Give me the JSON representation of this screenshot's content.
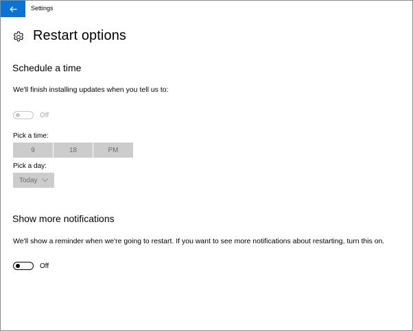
{
  "app": {
    "title": "Settings"
  },
  "page": {
    "title": "Restart options"
  },
  "schedule": {
    "heading": "Schedule a time",
    "description": "We'll finish installing updates when you tell us to:",
    "toggle_state": "Off",
    "pick_time_label": "Pick a time:",
    "hour": "9",
    "minute": "18",
    "ampm": "PM",
    "pick_day_label": "Pick a day:",
    "day": "Today"
  },
  "notifications": {
    "heading": "Show more notifications",
    "description": "We'll show a reminder when we're going to restart. If you want to see more notifications about restarting, turn this on.",
    "toggle_state": "Off"
  },
  "colors": {
    "accent": "#0a74d6",
    "disabled_fill": "#cccccc",
    "disabled_text": "#a8a8a8"
  },
  "icons": [
    "back-arrow-icon",
    "gear-icon",
    "chevron-down-icon"
  ]
}
